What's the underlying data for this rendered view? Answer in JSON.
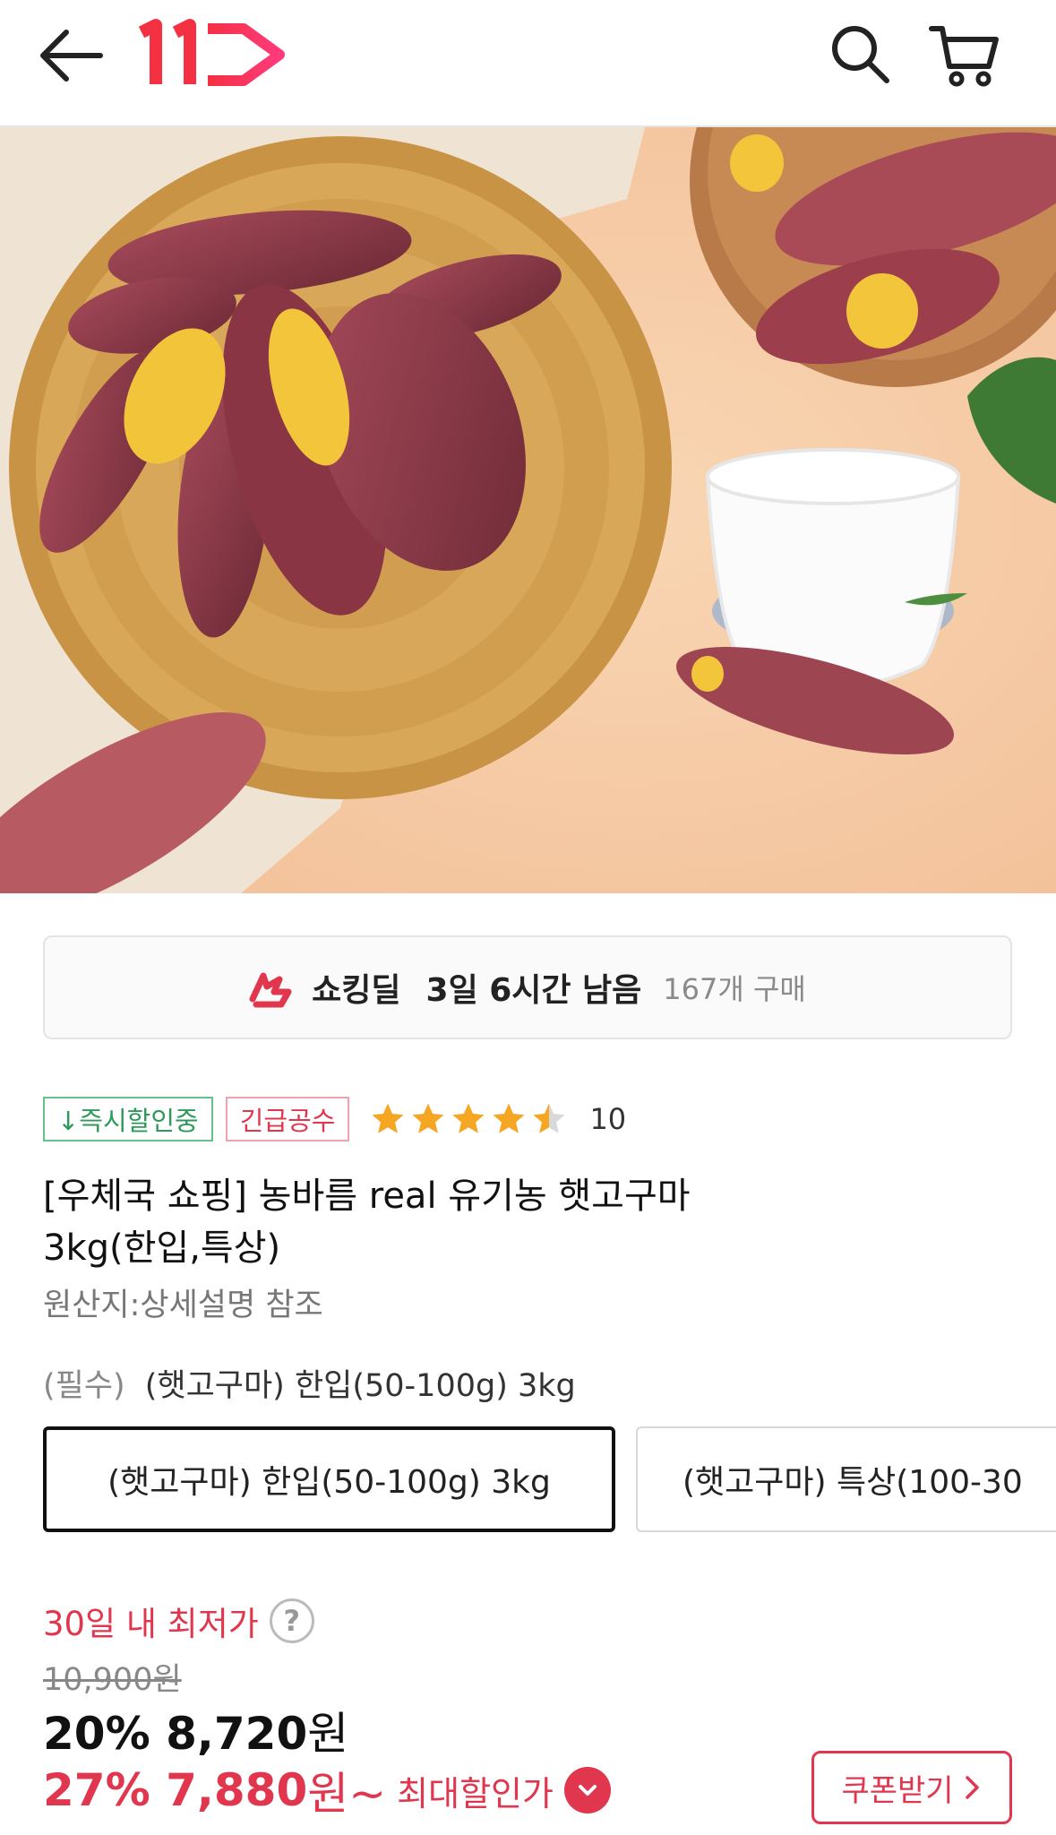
{
  "header": {
    "logo_text": "11",
    "icons": [
      "back-arrow-icon",
      "logo",
      "search-icon",
      "cart-icon"
    ]
  },
  "deal": {
    "name": "쇼킹딜",
    "remaining": "3일 6시간 남음",
    "purchase_count": "167개 구매"
  },
  "badges": {
    "instant_discount": "↓즉시할인중",
    "urgent": "긴급공수"
  },
  "rating": {
    "stars": 4.5,
    "count": "10"
  },
  "product": {
    "title_line1": "[우체국 쇼핑] 농바름 real 유기농 햇고구마",
    "title_line2": "3kg(한입,특상)",
    "origin": "원산지:상세설명 참조"
  },
  "option": {
    "required_label": "(필수)",
    "selected_value": "(햇고구마) 한입(50-100g) 3kg",
    "choices": [
      "(햇고구마) 한입(50-100g) 3kg",
      "(햇고구마) 특상(100-30"
    ]
  },
  "price": {
    "lowest_label": "30일 내 최저가",
    "help_icon_text": "?",
    "original": "10,900원",
    "discount_rate": "20%",
    "sale_price": "8,720",
    "sale_unit": "원",
    "max_rate": "27%",
    "max_price": "7,880",
    "max_unit": "원~",
    "max_label": "최대할인가",
    "coupon_label": "쿠폰받기"
  },
  "colors": {
    "accent_red": "#e0374f",
    "green": "#2e9a5a",
    "star": "#f5a623"
  }
}
